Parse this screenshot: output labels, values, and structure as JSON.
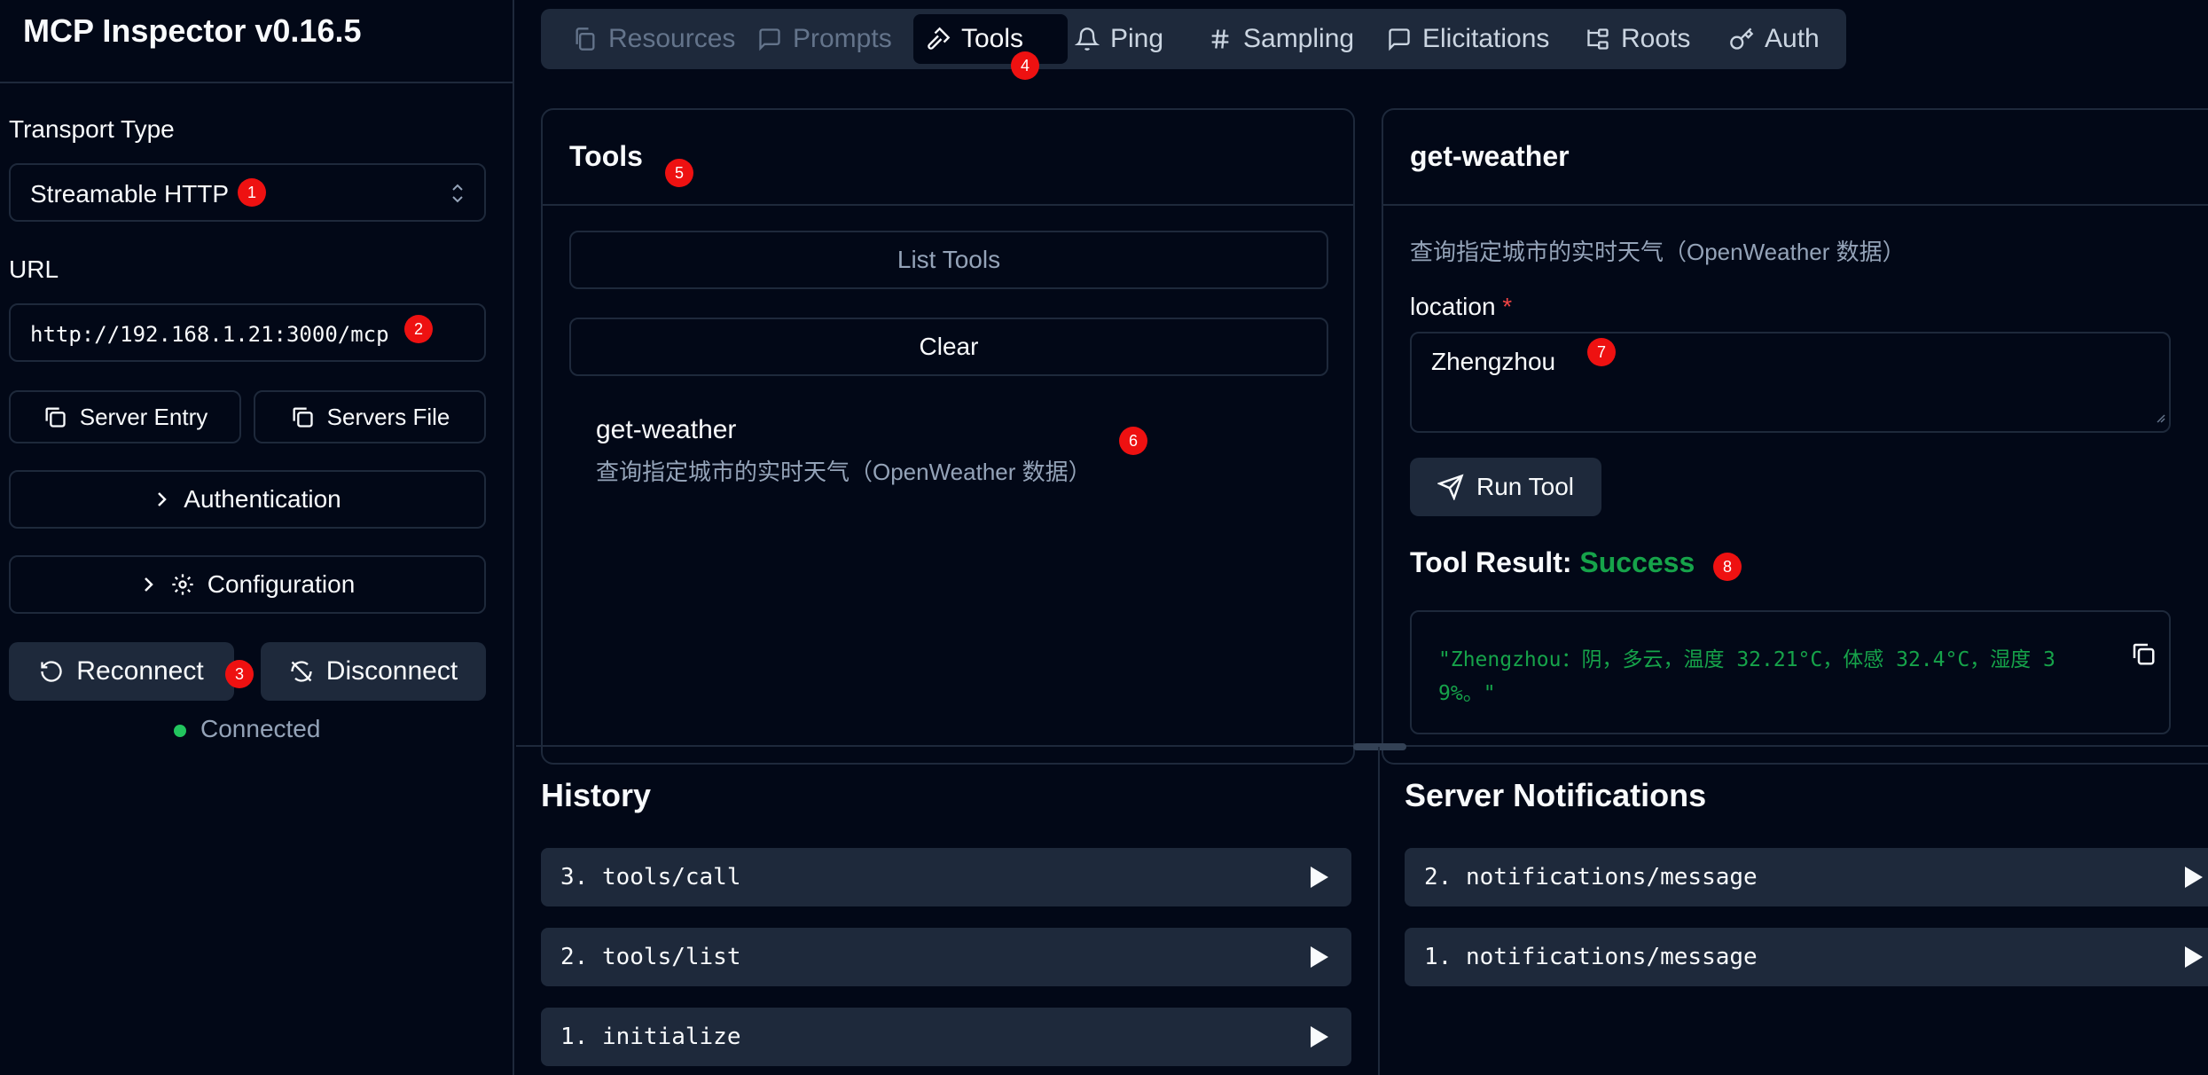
{
  "app": {
    "title": "MCP Inspector v0.16.5"
  },
  "sidebar": {
    "transport_label": "Transport Type",
    "transport_value": "Streamable HTTP",
    "url_label": "URL",
    "url_value": "http://192.168.1.21:3000/mcp",
    "server_entry_label": "Server Entry",
    "servers_file_label": "Servers File",
    "authentication_label": "Authentication",
    "configuration_label": "Configuration",
    "reconnect_label": "Reconnect",
    "disconnect_label": "Disconnect",
    "status_text": "Connected",
    "status_color": "#22c55e"
  },
  "tabs": [
    {
      "label": "Resources",
      "icon": "files-icon",
      "state": "disabled"
    },
    {
      "label": "Prompts",
      "icon": "message-square-icon",
      "state": "disabled"
    },
    {
      "label": "Tools",
      "icon": "hammer-icon",
      "state": "active"
    },
    {
      "label": "Ping",
      "icon": "bell-icon",
      "state": "normal"
    },
    {
      "label": "Sampling",
      "icon": "hash-icon",
      "state": "normal"
    },
    {
      "label": "Elicitations",
      "icon": "message-square-icon",
      "state": "normal"
    },
    {
      "label": "Roots",
      "icon": "folder-tree-icon",
      "state": "normal"
    },
    {
      "label": "Auth",
      "icon": "key-icon",
      "state": "normal"
    }
  ],
  "tools_panel": {
    "title": "Tools",
    "list_tools_label": "List Tools",
    "clear_label": "Clear",
    "items": [
      {
        "name": "get-weather",
        "description": "查询指定城市的实时天气（OpenWeather 数据）"
      }
    ]
  },
  "tool_detail": {
    "title": "get-weather",
    "description": "查询指定城市的实时天气（OpenWeather 数据）",
    "param_label": "location",
    "param_required_mark": "*",
    "param_value": "Zhengzhou",
    "run_label": "Run Tool",
    "result_label": "Tool Result:",
    "result_status": "Success",
    "result_status_color": "#16a34a",
    "result_text_line1": "\"Zhengzhou：阴，多云，温度 32.21°C，体感 32.4°C，湿度 3",
    "result_text_line2": "9%。\"",
    "result_text_color": "#16a34a"
  },
  "history": {
    "title": "History",
    "items": [
      "3. tools/call",
      "2. tools/list",
      "1. initialize"
    ]
  },
  "notifications": {
    "title": "Server Notifications",
    "items": [
      "2. notifications/message",
      "1. notifications/message"
    ]
  },
  "badges": [
    "1",
    "2",
    "3",
    "4",
    "5",
    "6",
    "7",
    "8"
  ]
}
